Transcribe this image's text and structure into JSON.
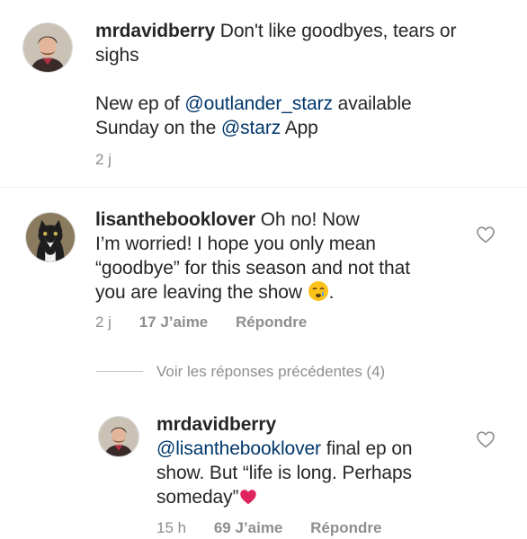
{
  "post": {
    "username": "mrdavidberry",
    "caption_line1": "Don't like goodbyes, tears or",
    "caption_line2": "sighs",
    "caption_line3_pre": "New ep of ",
    "caption_mention1": "@outlander_starz",
    "caption_line3_post": " available",
    "caption_line4_pre": "Sunday on the ",
    "caption_mention2": "@starz",
    "caption_line4_post": " App",
    "time": "2 j"
  },
  "comment1": {
    "username": "lisanthebooklover",
    "text_line1": "Oh no! Now",
    "text_line2": "I’m worried! I hope you only mean",
    "text_line3": "“goodbye” for this season and not that",
    "text_line4_pre": "you are leaving the show ",
    "text_line4_post": ".",
    "emoji": "crying-face-emoji",
    "time": "2 j",
    "likes": "17 J’aime",
    "reply_label": "Répondre"
  },
  "view_replies": "Voir les réponses précédentes (4)",
  "reply1": {
    "username": "mrdavidberry",
    "mention": "@lisanthebooklover",
    "text_line1_post": " final ep on",
    "text_line2": "show. But “life is long. Perhaps",
    "text_line3": "someday”",
    "emoji": "red-heart-emoji",
    "time": "15 h",
    "likes": "69 J’aime",
    "reply_label": "Répondre"
  },
  "colors": {
    "text": "#262626",
    "mention": "#00376b",
    "meta": "#8e8e8e",
    "heart_emoji": "#e0245e"
  }
}
